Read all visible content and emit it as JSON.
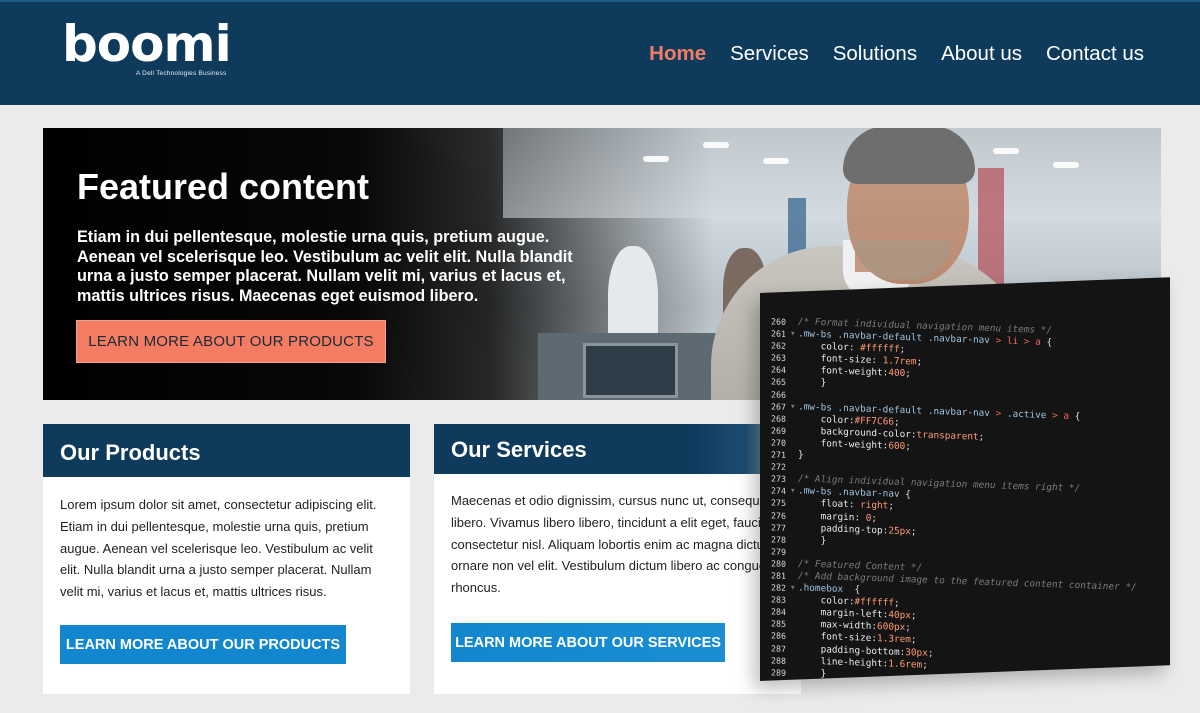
{
  "brand": {
    "name": "boomi",
    "tagline": "A Dell Technologies Business"
  },
  "nav": [
    "Home",
    "Services",
    "Solutions",
    "About us",
    "Contact us"
  ],
  "hero": {
    "title": "Featured content",
    "text": "Etiam in dui pellentesque, molestie urna quis, pretium augue. Aenean vel scelerisque leo. Vestibulum ac velit elit. Nulla blandit urna a justo semper placerat. Nullam velit mi, varius et lacus et, mattis ultrices risus. Maecenas eget euismod libero.",
    "button": "LEARN MORE ABOUT OUR PRODUCTS"
  },
  "products": {
    "title": "Our Products",
    "text": "Lorem ipsum dolor sit amet, consectetur adipiscing elit. Etiam in dui pellentesque, molestie urna quis, pretium augue. Aenean vel scelerisque leo. Vestibulum ac velit elit. Nulla blandit urna a justo semper placerat. Nullam velit mi, varius et lacus et, mattis ultrices risus.",
    "button": "LEARN MORE ABOUT OUR PRODUCTS"
  },
  "services": {
    "title": "Our Services",
    "text": "Maecenas et odio dignissim, cursus nunc ut, consequat libero. Vivamus libero libero, tincidunt a elit eget, faucibus consectetur nisl. Aliquam lobortis enim ac magna dictum ornare non vel elit. Vestibulum dictum libero ac congue rhoncus.",
    "button": "LEARN MORE ABOUT OUR SERVICES"
  },
  "code_lines": [
    {
      "n": "260",
      "fold": "",
      "t": "/* Format individual navigation menu items */"
    },
    {
      "n": "261",
      "fold": "▾",
      "t": ".mw-bs .navbar-default .navbar-nav > li > a {"
    },
    {
      "n": "262",
      "fold": "",
      "t": "    color: #ffffff;"
    },
    {
      "n": "263",
      "fold": "",
      "t": "    font-size: 1.7rem;"
    },
    {
      "n": "264",
      "fold": "",
      "t": "    font-weight:400;"
    },
    {
      "n": "265",
      "fold": "",
      "t": "    }"
    },
    {
      "n": "266",
      "fold": "",
      "t": ""
    },
    {
      "n": "267",
      "fold": "▾",
      "t": ".mw-bs .navbar-default .navbar-nav > .active > a {"
    },
    {
      "n": "268",
      "fold": "",
      "t": "    color:#FF7C66;"
    },
    {
      "n": "269",
      "fold": "",
      "t": "    background-color:transparent;"
    },
    {
      "n": "270",
      "fold": "",
      "t": "    font-weight:600;"
    },
    {
      "n": "271",
      "fold": "",
      "t": "}"
    },
    {
      "n": "272",
      "fold": "",
      "t": ""
    },
    {
      "n": "273",
      "fold": "",
      "t": "/* Align individual navigation menu items right */"
    },
    {
      "n": "274",
      "fold": "▾",
      "t": ".mw-bs .navbar-nav {"
    },
    {
      "n": "275",
      "fold": "",
      "t": "    float: right;"
    },
    {
      "n": "276",
      "fold": "",
      "t": "    margin: 0;"
    },
    {
      "n": "277",
      "fold": "",
      "t": "    padding-top:25px;"
    },
    {
      "n": "278",
      "fold": "",
      "t": "    }"
    },
    {
      "n": "279",
      "fold": "",
      "t": ""
    },
    {
      "n": "280",
      "fold": "",
      "t": "/* Featured Content */"
    },
    {
      "n": "281",
      "fold": "",
      "t": "/* Add background image to the featured content container */"
    },
    {
      "n": "282",
      "fold": "▾",
      "t": ".homebox  {"
    },
    {
      "n": "283",
      "fold": "",
      "t": "    color:#ffffff;"
    },
    {
      "n": "284",
      "fold": "",
      "t": "    margin-left:40px;"
    },
    {
      "n": "285",
      "fold": "",
      "t": "    max-width:600px;"
    },
    {
      "n": "286",
      "fold": "",
      "t": "    font-size:1.3rem;"
    },
    {
      "n": "287",
      "fold": "",
      "t": "    padding-bottom:30px;"
    },
    {
      "n": "288",
      "fold": "",
      "t": "    line-height:1.6rem;"
    },
    {
      "n": "289",
      "fold": "",
      "t": "    }"
    }
  ],
  "colors": {
    "header": "#0e3a5c",
    "accent": "#f47c62",
    "button_blue": "#1287cf",
    "code_bg": "#141414"
  },
  "icons": [
    "fold-arrow-icon"
  ]
}
